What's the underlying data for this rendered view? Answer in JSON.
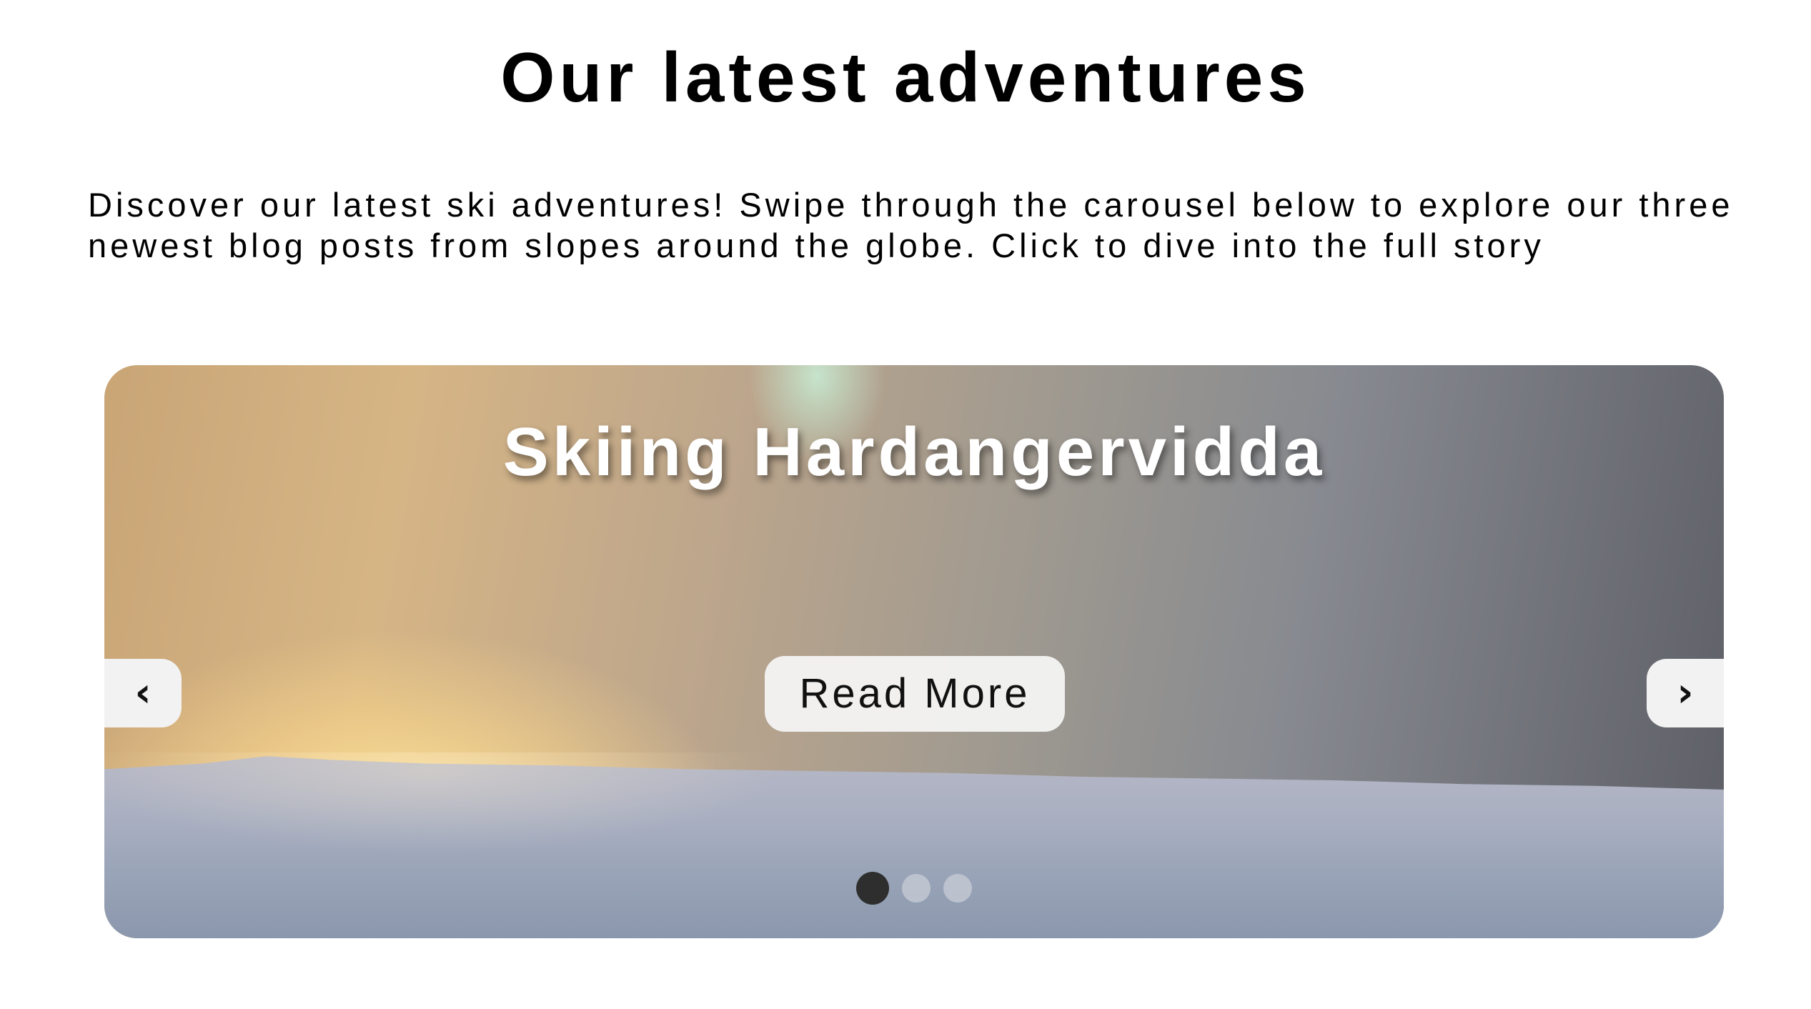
{
  "header": {
    "title": "Our latest adventures"
  },
  "intro": {
    "text": "Discover our latest ski adventures! Swipe through the carousel below to explore our three newest blog posts from slopes around the globe. Click to dive into the full story"
  },
  "carousel": {
    "slide_title": "Skiing Hardangervidda",
    "read_more_label": "Read More",
    "prev_icon": "‹",
    "next_icon": "›",
    "dots_total": 3,
    "active_dot_index": 0,
    "colors": {
      "title_text": "#ffffff",
      "button_bg": "#f4f4f4",
      "active_dot": "#2e2e2e"
    }
  }
}
